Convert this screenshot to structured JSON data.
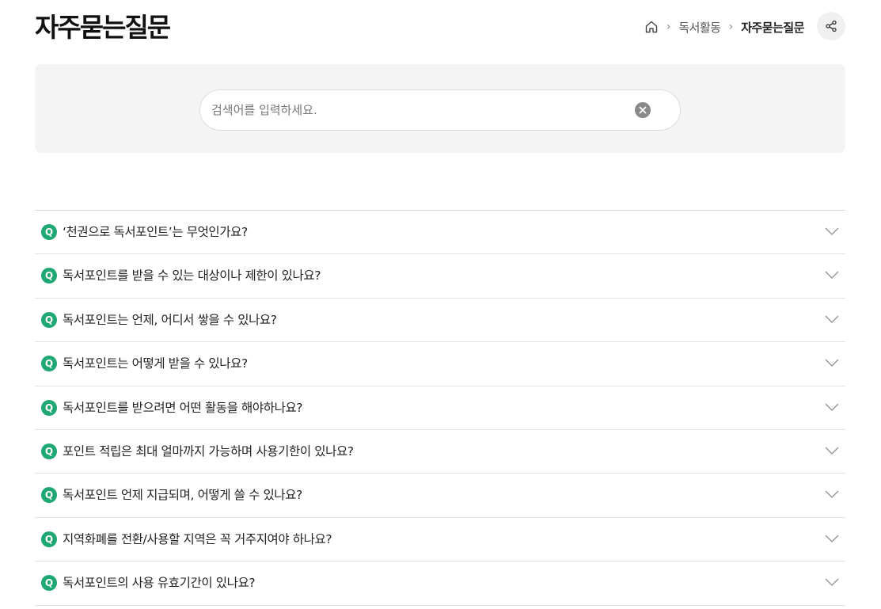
{
  "page": {
    "title": "자주묻는질문"
  },
  "breadcrumb": {
    "home_icon": "home-icon",
    "separator": "›",
    "items": [
      "독서활동",
      "자주묻는질문"
    ]
  },
  "share": {
    "icon": "share-icon"
  },
  "search": {
    "placeholder": "검색어를 입력하세요.",
    "value": "",
    "clear_icon": "clear-icon"
  },
  "faq": {
    "badge": "Q",
    "items": [
      {
        "question": "‘천권으로 독서포인트’는 무엇인가요?"
      },
      {
        "question": "독서포인트를 받을 수 있는 대상이나 제한이 있나요?"
      },
      {
        "question": "독서포인트는 언제, 어디서 쌓을 수 있나요?"
      },
      {
        "question": "독서포인트는 어떻게 받을 수 있나요?"
      },
      {
        "question": "독서포인트를 받으려면 어떤 활동을 해야하나요?"
      },
      {
        "question": "포인트 적립은 최대 얼마까지 가능하며 사용기한이 있나요?"
      },
      {
        "question": "독서포인트 언제 지급되며, 어떻게 쓸 수 있나요?"
      },
      {
        "question": "지역화폐를 전환/사용할 지역은 꼭 거주지여야 하나요?"
      },
      {
        "question": "독서포인트의 사용 유효기간이 있나요?"
      }
    ]
  },
  "colors": {
    "accent": "#1fa874",
    "panel_bg": "#f4f4f4",
    "border": "#dddddd"
  }
}
